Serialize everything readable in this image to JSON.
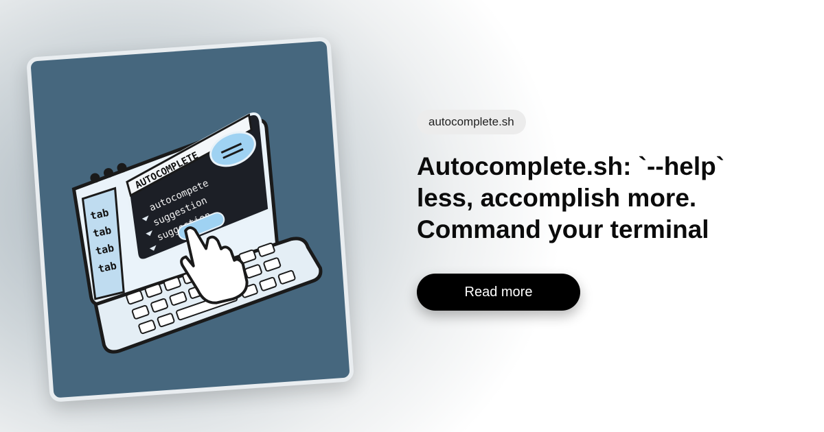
{
  "tag": {
    "label": "autocomplete.sh"
  },
  "headline": {
    "line1": "Autocomplete.sh: `--help`",
    "line2": "less, accomplish more.",
    "line3": "Command your terminal"
  },
  "cta": {
    "label": "Read more"
  },
  "illustration": {
    "window_title": "AUTOCOMPLETE",
    "suggestions": [
      "autocompete",
      "suggestion",
      "suggestion"
    ],
    "side_keys": [
      "tab",
      "tab",
      "tab",
      "tab"
    ],
    "icons": [
      "terminal-window-icon",
      "pointing-hand-icon",
      "keyboard-icon"
    ]
  },
  "colors": {
    "card_bg": "#46677e",
    "accent_light": "#a9d4f0",
    "button_bg": "#000000"
  }
}
